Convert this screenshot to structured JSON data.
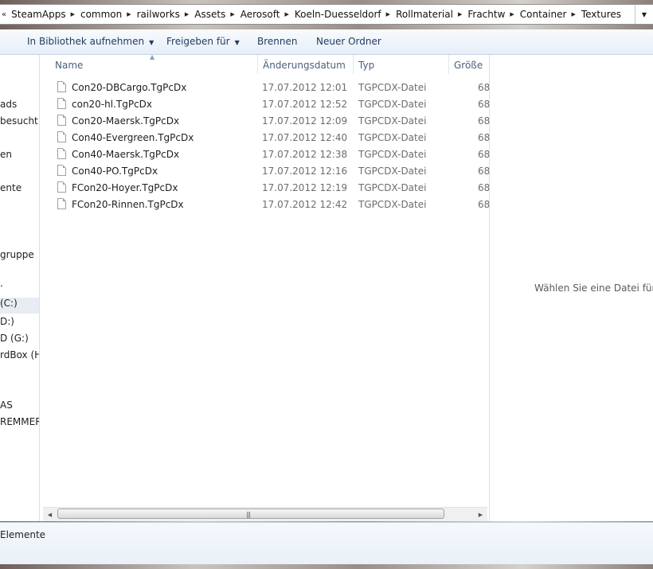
{
  "address": {
    "lead": "«",
    "crumbs": [
      "SteamApps",
      "common",
      "railworks",
      "Assets",
      "Aerosoft",
      "Koeln-Duesseldorf",
      "Rollmaterial",
      "Frachtw",
      "Container",
      "Textures"
    ],
    "dropdown_icon": "chevron-down-icon"
  },
  "toolbar": {
    "library": "In Bibliothek aufnehmen",
    "share": "Freigeben für",
    "burn": "Brennen",
    "new_folder": "Neuer Ordner"
  },
  "nav": {
    "items": [
      "ads",
      "besucht",
      "en",
      "ente",
      "gruppe",
      ".",
      "(C:)",
      "D:)",
      "D (G:)",
      "rdBox (H",
      "AS",
      "REMMER"
    ]
  },
  "columns": {
    "name": "Name",
    "date": "Änderungsdatum",
    "type": "Typ",
    "size": "Größe"
  },
  "files": [
    {
      "name": "Con20-DBCargo.TgPcDx",
      "date": "17.07.2012 12:01",
      "type": "TGPCDX-Datei",
      "size": "68"
    },
    {
      "name": "con20-hl.TgPcDx",
      "date": "17.07.2012 12:52",
      "type": "TGPCDX-Datei",
      "size": "68"
    },
    {
      "name": "Con20-Maersk.TgPcDx",
      "date": "17.07.2012 12:09",
      "type": "TGPCDX-Datei",
      "size": "68"
    },
    {
      "name": "Con40-Evergreen.TgPcDx",
      "date": "17.07.2012 12:40",
      "type": "TGPCDX-Datei",
      "size": "68"
    },
    {
      "name": "Con40-Maersk.TgPcDx",
      "date": "17.07.2012 12:38",
      "type": "TGPCDX-Datei",
      "size": "68"
    },
    {
      "name": "Con40-PO.TgPcDx",
      "date": "17.07.2012 12:16",
      "type": "TGPCDX-Datei",
      "size": "68"
    },
    {
      "name": "FCon20-Hoyer.TgPcDx",
      "date": "17.07.2012 12:19",
      "type": "TGPCDX-Datei",
      "size": "68"
    },
    {
      "name": "FCon20-Rinnen.TgPcDx",
      "date": "17.07.2012 12:42",
      "type": "TGPCDX-Datei",
      "size": "68"
    }
  ],
  "preview": {
    "message": "Wählen Sie eine Datei für die"
  },
  "details": {
    "count_text": "Elemente"
  }
}
